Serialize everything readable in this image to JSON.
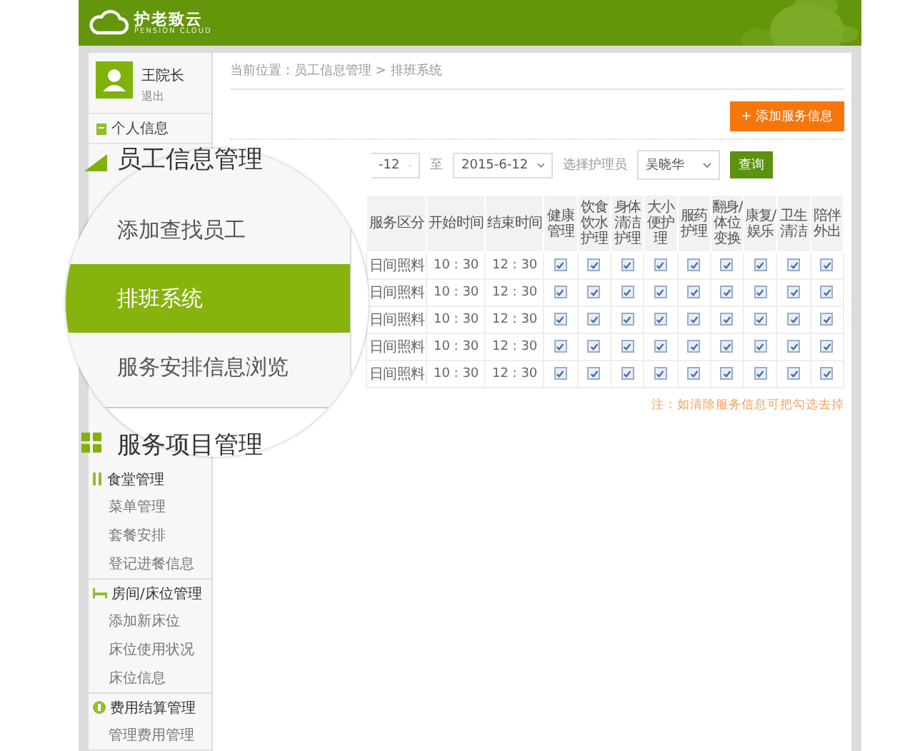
{
  "header": {
    "logo_text": "护老致云",
    "logo_subtitle": "PENSION CLOUD"
  },
  "user": {
    "name": "王院长",
    "logout": "退出"
  },
  "sidebar": {
    "top_item": "个人信息",
    "groups": [
      {
        "kind": "dining",
        "title": "食堂管理",
        "items": [
          "菜单管理",
          "套餐安排",
          "登记进餐信息"
        ]
      },
      {
        "kind": "room",
        "title": "房间/床位管理",
        "items": [
          "添加新床位",
          "床位使用状况",
          "床位信息"
        ]
      },
      {
        "kind": "billing",
        "title": "费用结算管理",
        "items": [
          "管理费用管理"
        ]
      }
    ]
  },
  "breadcrumb": "当前位置：员工信息管理 > 排班系统",
  "add_button": "+ 添加服务信息",
  "filter": {
    "start_date": "-12",
    "to_label": "至",
    "end_date": "2015-6-12",
    "caregiver_label": "选择护理员",
    "caregiver": "吴晓华",
    "query_button": "查询"
  },
  "table": {
    "columns": [
      "服务区分",
      "开始时间",
      "结束时间",
      "健康管理",
      "饮食饮水护理",
      "身体清洁护理",
      "大小便护理",
      "服药护理",
      "翻身/体位变换",
      "康复/娱乐",
      "卫生清洁",
      "陪伴外出"
    ],
    "rows": [
      {
        "area": "日间照料",
        "start": "10 : 30",
        "end": "12 : 30",
        "checks": [
          true,
          true,
          true,
          true,
          true,
          true,
          true,
          true,
          true
        ]
      },
      {
        "area": "日间照料",
        "start": "10 : 30",
        "end": "12 : 30",
        "checks": [
          true,
          true,
          true,
          true,
          true,
          true,
          true,
          true,
          true
        ]
      },
      {
        "area": "日间照料",
        "start": "10 : 30",
        "end": "12 : 30",
        "checks": [
          true,
          true,
          true,
          true,
          true,
          true,
          true,
          true,
          true
        ]
      },
      {
        "area": "日间照料",
        "start": "10 : 30",
        "end": "12 : 30",
        "checks": [
          true,
          true,
          true,
          true,
          true,
          true,
          true,
          true,
          true
        ]
      },
      {
        "area": "日间照料",
        "start": "10 : 30",
        "end": "12 : 30",
        "checks": [
          true,
          true,
          true,
          true,
          true,
          true,
          true,
          true,
          true
        ]
      }
    ]
  },
  "note": "注：如清除服务信息可把勾选去掉",
  "magnifier": {
    "section_title": "员工信息管理",
    "items": [
      {
        "label": "添加查找员工",
        "selected": false
      },
      {
        "label": "排班系统",
        "selected": true
      },
      {
        "label": "服务安排信息浏览",
        "selected": false
      }
    ],
    "next_section_title": "服务项目管理"
  }
}
